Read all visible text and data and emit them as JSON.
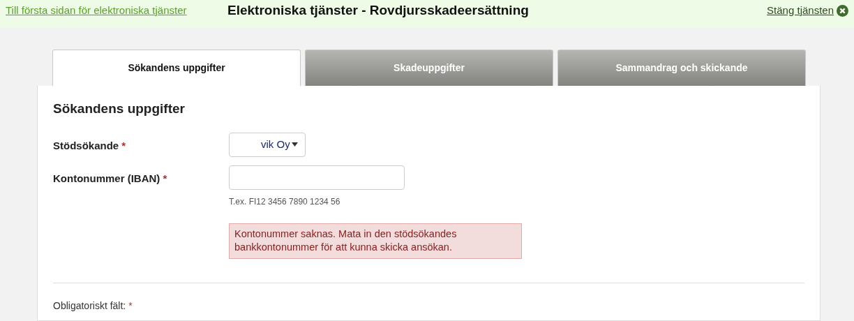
{
  "header": {
    "home_link": "Till första sidan för elektroniska tjänster",
    "title": "Elektroniska tjänster - Rovdjursskadeersättning",
    "close_link": "Stäng tjänsten"
  },
  "tabs": [
    {
      "label": "Sökandens uppgifter",
      "selected": true
    },
    {
      "label": "Skadeuppgifter",
      "selected": false
    },
    {
      "label": "Sammandrag och skickande",
      "selected": false
    }
  ],
  "section_title": "Sökandens uppgifter",
  "fields": [
    {
      "kind": "select",
      "label": "Stödsökande",
      "required_mark": "*",
      "value": "vik Oy"
    },
    {
      "kind": "input",
      "label": "Kontonummer (IBAN)",
      "required_mark": "*",
      "hint": "T.ex. FI12 3456 7890 1234 56",
      "error": "Kontonummer saknas. Mata in den stödsökandes bankkontonummer för att kunna skicka ansökan."
    }
  ],
  "footer_note": {
    "label": "Obligatoriskt fält:",
    "required_mark": "*"
  }
}
